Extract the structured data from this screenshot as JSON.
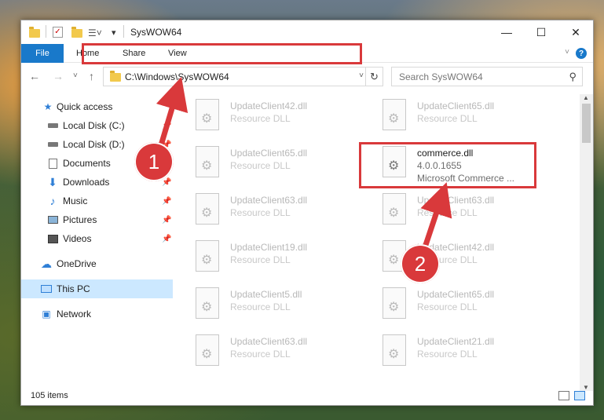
{
  "window": {
    "title": "SysWOW64",
    "minimize": "—",
    "maximize": "☐",
    "close": "✕"
  },
  "ribbon": {
    "tabs": [
      "File",
      "Home",
      "Share",
      "View"
    ],
    "help": "?"
  },
  "nav": {
    "back": "←",
    "forward": "→",
    "recent": "˅",
    "up": "↑"
  },
  "address": {
    "path": "C:\\Windows\\SysWOW64",
    "refresh": "↻",
    "dropdown": "˅"
  },
  "search": {
    "placeholder": "Search SysWOW64"
  },
  "sidebar": {
    "items": [
      {
        "label": "Quick access",
        "icon": "star-icon"
      },
      {
        "label": "Local Disk (C:)",
        "icon": "drive-icon"
      },
      {
        "label": "Local Disk (D:)",
        "icon": "drive-icon"
      },
      {
        "label": "Documents",
        "icon": "documents-icon"
      },
      {
        "label": "Downloads",
        "icon": "downloads-icon"
      },
      {
        "label": "Music",
        "icon": "music-icon"
      },
      {
        "label": "Pictures",
        "icon": "pictures-icon"
      },
      {
        "label": "Videos",
        "icon": "videos-icon"
      },
      {
        "label": "OneDrive",
        "icon": "cloud-icon"
      },
      {
        "label": "This PC",
        "icon": "computer-icon"
      },
      {
        "label": "Network",
        "icon": "network-icon"
      }
    ]
  },
  "files": {
    "left": [
      {
        "name": "UpdateClient42.dll",
        "type": "Resource DLL"
      },
      {
        "name": "UpdateClient65.dll",
        "type": "Resource DLL"
      },
      {
        "name": "UpdateClient63.dll",
        "type": "Resource DLL"
      },
      {
        "name": "UpdateClient19.dll",
        "type": "Resource DLL"
      },
      {
        "name": "UpdateClient5.dll",
        "type": "Resource DLL"
      },
      {
        "name": "UpdateClient63.dll",
        "type": "Resource DLL"
      }
    ],
    "right": [
      {
        "name": "UpdateClient65.dll",
        "type": "Resource DLL"
      },
      {
        "name": "commerce.dll",
        "type": "4.0.0.1655",
        "desc": "Microsoft Commerce ..."
      },
      {
        "name": "UpdateClient63.dll",
        "type": "Resource DLL"
      },
      {
        "name": "UpdateClient42.dll",
        "type": "Resource DLL"
      },
      {
        "name": "UpdateClient65.dll",
        "type": "Resource DLL"
      },
      {
        "name": "UpdateClient21.dll",
        "type": "Resource DLL"
      }
    ]
  },
  "status": {
    "count": "105 items"
  },
  "annotations": {
    "badge1": "1",
    "badge2": "2"
  },
  "colors": {
    "accent": "#1979ca",
    "highlight": "#d9393b",
    "selection": "#cce8ff"
  }
}
